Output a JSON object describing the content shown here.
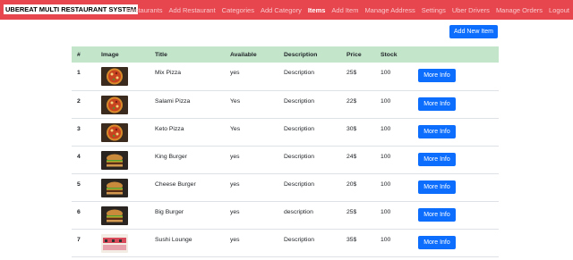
{
  "nav": {
    "brand": "UBEREAT MULTI RESTAURANT SYSTEM",
    "links": [
      "Restaurants",
      "Add Restaurant",
      "Categories",
      "Add Category",
      "Items",
      "Add Item",
      "Manage Address",
      "Settings",
      "Uber Drivers",
      "Manage Orders",
      "Logout"
    ],
    "active_index": 4
  },
  "add_button": "Add New Item",
  "table": {
    "headers": [
      "#",
      "Image",
      "Title",
      "Available",
      "Description",
      "Price",
      "Stock",
      ""
    ],
    "rows": [
      {
        "num": "1",
        "image": "pizza-photo",
        "title": "Mix Pizza",
        "available": "yes",
        "description": "Description",
        "price": "25$",
        "stock": "100",
        "action": "More Info"
      },
      {
        "num": "2",
        "image": "pizza-photo",
        "title": "Salami Pizza",
        "available": "Yes",
        "description": "Description",
        "price": "22$",
        "stock": "100",
        "action": "More Info"
      },
      {
        "num": "3",
        "image": "pizza-photo",
        "title": "Keto Pizza",
        "available": "Yes",
        "description": "Description",
        "price": "30$",
        "stock": "100",
        "action": "More Info"
      },
      {
        "num": "4",
        "image": "burger-photo",
        "title": "King Burger",
        "available": "yes",
        "description": "Description",
        "price": "24$",
        "stock": "100",
        "action": "More Info"
      },
      {
        "num": "5",
        "image": "burger-photo",
        "title": "Cheese Burger",
        "available": "yes",
        "description": "Description",
        "price": "20$",
        "stock": "100",
        "action": "More Info"
      },
      {
        "num": "6",
        "image": "burger-photo",
        "title": "Big Burger",
        "available": "yes",
        "description": "description",
        "price": "25$",
        "stock": "100",
        "action": "More Info"
      },
      {
        "num": "7",
        "image": "sushi-photo",
        "title": "Sushi Lounge",
        "available": "yes",
        "description": "Description",
        "price": "35$",
        "stock": "100",
        "action": "More Info"
      }
    ]
  },
  "colors": {
    "navbar": "#e8464f",
    "header_row": "#c3e6cb",
    "button": "#0d6efd"
  }
}
